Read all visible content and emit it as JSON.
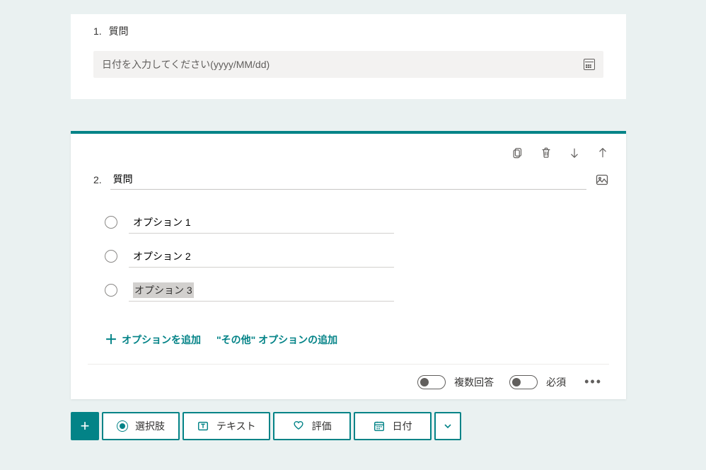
{
  "q1": {
    "number": "1.",
    "title": "質問",
    "date_placeholder": "日付を入力してください(yyyy/MM/dd)"
  },
  "q2": {
    "number": "2.",
    "title": "質問",
    "options": [
      "オプション 1",
      "オプション 2",
      "オプション 3"
    ],
    "add_option": "オプションを追加",
    "add_other": "\"その他\" オプションの追加",
    "multi_label": "複数回答",
    "required_label": "必須"
  },
  "types": {
    "choice": "選択肢",
    "text": "テキスト",
    "rating": "評価",
    "date": "日付"
  }
}
